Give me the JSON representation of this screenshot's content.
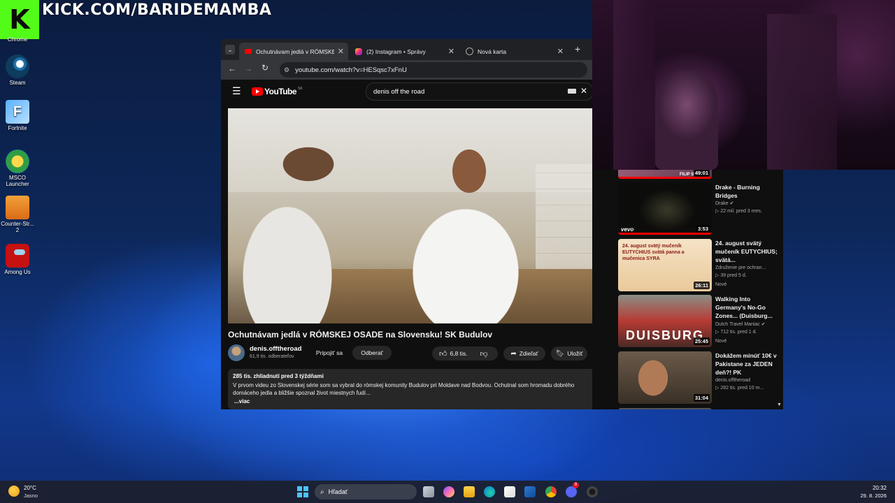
{
  "overlay": {
    "logo_letter": "K",
    "stream_url": "KICK.COM/BARIDEMAMBA"
  },
  "desktop_icons": [
    {
      "label": "Chrome"
    },
    {
      "label": "Steam"
    },
    {
      "label": "Fortnite"
    },
    {
      "label": "MSCO Launcher"
    },
    {
      "label": "Counter-Str... 2"
    },
    {
      "label": "Among Us"
    }
  ],
  "browser": {
    "tabs": [
      {
        "label": "Ochutnávam jedlá v RÓMSKEJ"
      },
      {
        "label": "(2) Instagram • Správy"
      },
      {
        "label": "Nová karta"
      }
    ],
    "url": "youtube.com/watch?v=HESqsc7xFnU"
  },
  "youtube": {
    "logo_text": "YouTube",
    "region": "SK",
    "search_query": "denis off the road",
    "video_title": "Ochutnávam jedlá v RÓMSKEJ OSADE na Slovensku! SK Budulov",
    "channel_name": "denis.offtheroad",
    "subscribers": "61,9 tis. odberateľov",
    "join_label": "Pripojiť sa",
    "subscribe_label": "Odberať",
    "likes": "6,8 tis.",
    "share_label": "Zdieľať",
    "save_label": "Uložiť",
    "views_date": "285 tis. zhliadnutí  pred 3 týždňami",
    "description": "V prvom videu zo Slovenskej série som sa vybral do rómskej komunity Budulov pri Moldave nad Bodvou. Ochutnal som hromadu dobrého domáceho jedla a bližšie spoznal život miestnych ľudí...",
    "more_label": "...viac",
    "recommendations": [
      {
        "title": "",
        "channel": "",
        "stats": "",
        "badge": "",
        "duration": "49:01",
        "overlay": "FILIP SI"
      },
      {
        "title": "Drake - Burning Bridges",
        "channel": "Drake",
        "stats": "22 mil.  pred 3 mes.",
        "badge": "",
        "duration": "3:53",
        "overlay": "vevo"
      },
      {
        "title": "24. august  svätý mučeník EUTYCHIUS; svätá...",
        "channel": "Združenie pre ochran...",
        "stats": "39  pred 5 d.",
        "badge": "Nové",
        "duration": "26:11",
        "overlay": "24. august  svätý mučeník EUTYCHIUS  svätá panna a mučenica SYRA"
      },
      {
        "title": "Walking Into Germany's No-Go Zones... (Duisburg...",
        "channel": "Dutch Travel Maniac",
        "stats": "712 tis.  pred 1 d.",
        "badge": "Nové",
        "duration": "25:45",
        "overlay": "DUISBURG"
      },
      {
        "title": "Dokážem minúť 10€ v Pakistane za JEDEN deň?! PK",
        "channel": "denis.offtheroad",
        "stats": "282 tis.  pred 10 m...",
        "badge": "",
        "duration": "31:04",
        "overlay": ""
      }
    ]
  },
  "taskbar": {
    "weather_temp": "20°C",
    "weather_desc": "Jasno",
    "search_placeholder": "Hľadať",
    "time": "20:32",
    "date": "29. 8. 2026",
    "discord_badge": "8"
  },
  "colors": {
    "kick_green": "#53fc18",
    "youtube_red": "#ff0000",
    "chrome_bg": "#202124"
  }
}
